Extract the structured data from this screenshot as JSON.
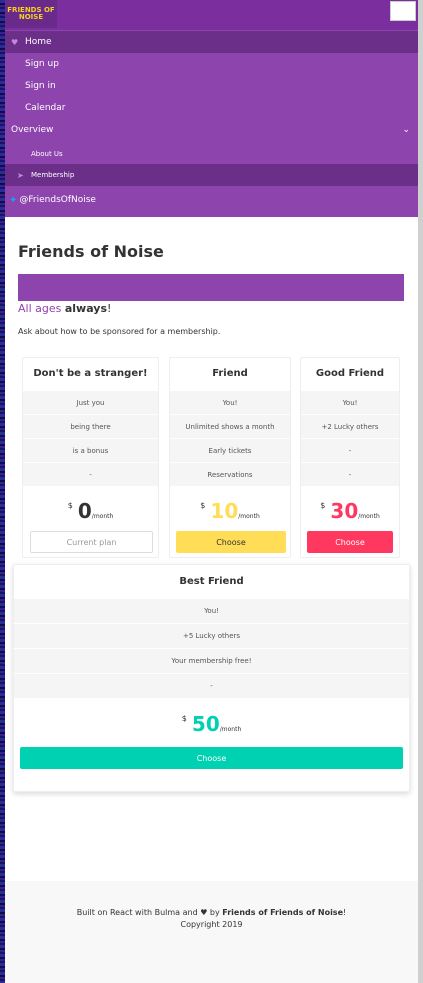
{
  "logo": {
    "text": "FRIENDS OF NOISE"
  },
  "nav": {
    "items": [
      {
        "label": "Home"
      },
      {
        "label": "Sign up"
      },
      {
        "label": "Sign in"
      },
      {
        "label": "Calendar"
      }
    ],
    "overview": "Overview",
    "about": "About Us",
    "membership": "Membership",
    "twitter": "@FriendsOfNoise"
  },
  "page": {
    "title": "Friends of Noise",
    "all_ages_lead": "All ages ",
    "all_ages_bold": "always",
    "all_ages_end": "!",
    "sponsor_text": "Ask about how to be sponsored for a membership."
  },
  "plans": [
    {
      "name": "Don't be a stranger!",
      "features": [
        "Just you",
        "being there",
        "is a bonus",
        "-"
      ],
      "currency": "$",
      "amount": "0",
      "per": "/month",
      "button": "Current plan",
      "color": "#333333"
    },
    {
      "name": "Friend",
      "features": [
        "You!",
        "Unlimited shows a month",
        "Early tickets",
        "Reservations"
      ],
      "currency": "$",
      "amount": "10",
      "per": "/month",
      "button": "Choose",
      "color": "#ffdd57"
    },
    {
      "name": "Good Friend",
      "features": [
        "You!",
        "+2 Lucky others",
        "-",
        "-"
      ],
      "currency": "$",
      "amount": "30",
      "per": "/month",
      "button": "Choose",
      "color": "#ff3860"
    },
    {
      "name": "Best Friend",
      "features": [
        "You!",
        "+5 Lucky others",
        "Your membership free!",
        "-"
      ],
      "currency": "$",
      "amount": "50",
      "per": "/month",
      "button": "Choose",
      "color": "#00d1b2"
    }
  ],
  "footer": {
    "built_prefix": "Built on React with Bulma and",
    "by": "by",
    "org": "Friends of Friends of Noise",
    "end": "!",
    "copyright": "Copyright 2019"
  },
  "colors": {
    "nav": "#8e44ad",
    "nav_active": "#6c2f89",
    "accent_friend": "#ffdd57",
    "accent_good": "#ff3860",
    "accent_best": "#00d1b2"
  }
}
